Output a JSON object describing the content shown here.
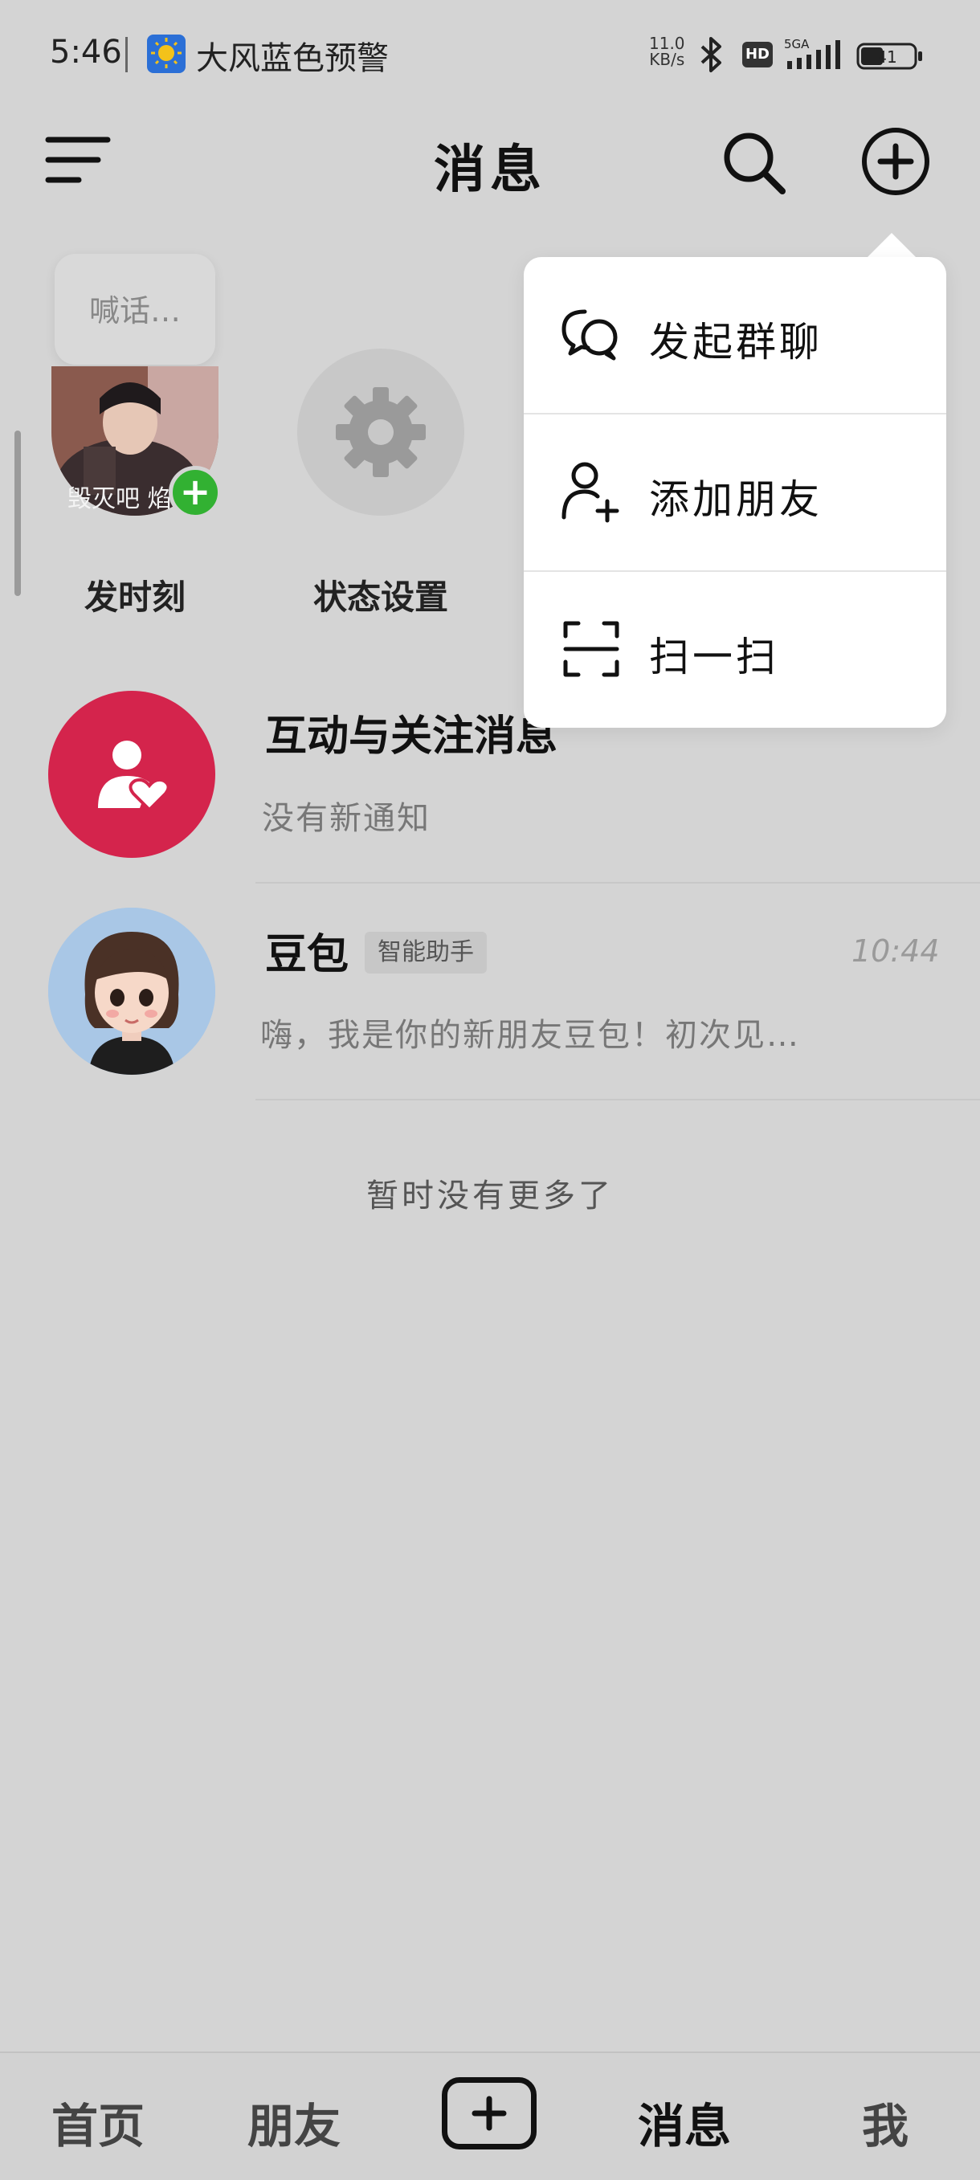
{
  "status_bar": {
    "time": "5:46",
    "alert_text": "大风蓝色预警",
    "net_speed_value": "11.0",
    "net_speed_unit": "KB/s",
    "hd_label": "HD",
    "network_label": "5GA",
    "battery": "41",
    "icons": [
      "weather-warning-icon",
      "bluetooth-icon",
      "hd-icon",
      "signal-icon",
      "battery-icon"
    ]
  },
  "header": {
    "title": "消息",
    "icons": [
      "menu-icon",
      "search-icon",
      "add-circle-icon"
    ]
  },
  "stories": {
    "bubble_text": "喊话…",
    "avatar_overlay_text": "毁灭吧 焰",
    "items": [
      {
        "label": "发时刻"
      },
      {
        "label": "状态设置"
      }
    ]
  },
  "conversations": [
    {
      "name": "互动与关注消息",
      "preview": "没有新通知"
    },
    {
      "name": "豆包",
      "badge": "智能助手",
      "time": "10:44",
      "preview": "嗨，我是你的新朋友豆包！初次见…"
    }
  ],
  "list_footer": "暂时没有更多了",
  "popup_menu": {
    "items": [
      {
        "label": "发起群聊",
        "icon": "group-chat-icon"
      },
      {
        "label": "添加朋友",
        "icon": "add-friend-icon"
      },
      {
        "label": "扫一扫",
        "icon": "scan-icon"
      }
    ]
  },
  "bottom_nav": {
    "items": [
      {
        "label": "首页"
      },
      {
        "label": "朋友"
      },
      {
        "label": "消息",
        "active": true
      },
      {
        "label": "我"
      }
    ],
    "center_icon": "create-plus-icon"
  },
  "colors": {
    "background": "#d4d4d4",
    "notice_avatar": "#d4244c",
    "add_badge": "#32b132",
    "popup": "#ffffff"
  }
}
